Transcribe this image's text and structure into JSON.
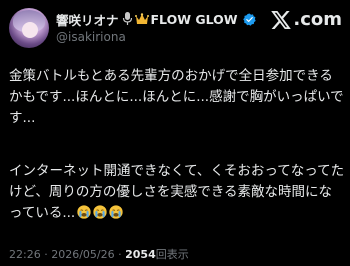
{
  "author": {
    "name": "響咲リオナ",
    "name_suffix": "FLOW GLOW",
    "handle": "@isakiriona"
  },
  "brand": {
    "logo_text": ".com",
    "logo_icon": "x-logo-icon"
  },
  "tweet": {
    "paragraph1": "金策バトルもとある先輩方のおかげで全日参加できるかもです...ほんとに...ほんとに...感謝で胸がいっぱいです...",
    "paragraph2": "インターネット開通できなくて、くそおおってなってたけど、周りの方の優しさを実感できる素敵な時間になっている..."
  },
  "meta": {
    "time": "22:26",
    "separator": " · ",
    "date": "2026/05/26",
    "views": "2054",
    "views_label": "回表示"
  },
  "colors": {
    "background": "#000000",
    "text": "#e7e9ea",
    "muted": "#71767b",
    "verified": "#1d9bf0"
  },
  "icons": [
    "microphone-icon",
    "crown-icon",
    "verified-badge-icon",
    "x-logo-icon",
    "crying-face-emoji"
  ]
}
